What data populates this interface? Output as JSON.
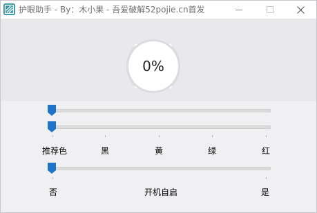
{
  "window": {
    "title": "护眼助手 - By：木小果 - 吾爱破解52pojie.cn首发",
    "icon": "app-logo-icon",
    "controls": [
      "minimize-icon",
      "maximize-icon",
      "close-icon"
    ]
  },
  "gauge": {
    "value_text": "0%",
    "value": 0
  },
  "sliders": [
    {
      "name": "brightness",
      "value_fraction": 0
    },
    {
      "name": "color",
      "value_fraction": 0,
      "ticks": [
        "推荐色",
        "黑",
        "黄",
        "绿",
        "红"
      ],
      "selected": "推荐色"
    },
    {
      "name": "autostart",
      "value_fraction": 0,
      "ticks": [
        "否",
        "是"
      ],
      "selected": "否"
    }
  ],
  "labels": {
    "color_options": [
      "推荐色",
      "黑",
      "黄",
      "绿",
      "红"
    ],
    "autostart_no": "否",
    "autostart_title": "开机自启",
    "autostart_yes": "是"
  },
  "colors": {
    "accent": "#1f73c8",
    "icon_bg": "#2b8f9e",
    "title_text": "#6f6f6f",
    "gauge_bg": "#e9e8eb",
    "controls_bg": "#f0eff2"
  }
}
